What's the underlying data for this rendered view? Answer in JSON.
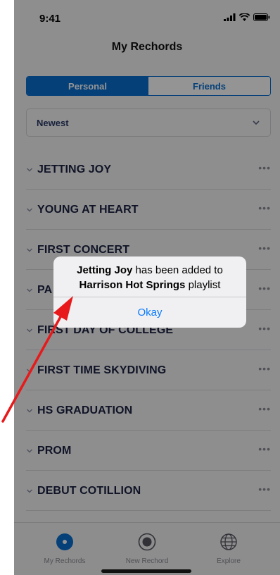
{
  "status_bar": {
    "time": "9:41",
    "icons": [
      "signal-icon",
      "wifi-icon",
      "battery-icon"
    ]
  },
  "header": {
    "title": "My Rechords"
  },
  "segments": [
    {
      "label": "Personal",
      "active": true
    },
    {
      "label": "Friends",
      "active": false
    }
  ],
  "sort": {
    "selected": "Newest"
  },
  "list": {
    "items": [
      {
        "title": "JETTING JOY"
      },
      {
        "title": "YOUNG AT HEART"
      },
      {
        "title": "FIRST CONCERT"
      },
      {
        "title": "PA"
      },
      {
        "title": "FIRST DAY OF COLLEGE"
      },
      {
        "title": "FIRST TIME SKYDIVING"
      },
      {
        "title": "HS GRADUATION"
      },
      {
        "title": "PROM"
      },
      {
        "title": "DEBUT COTILLION"
      }
    ],
    "more_label": "•••"
  },
  "alert": {
    "message_part1": "Jetting Joy",
    "message_part2": " has been added to",
    "message_part3": "Harrison Hot Springs",
    "message_part4": " playlist",
    "button_label": "Okay"
  },
  "tab_bar": {
    "tabs": [
      {
        "label": "My Rechords",
        "icon": "record-icon",
        "active": true
      },
      {
        "label": "New Rechord",
        "icon": "record-button-icon",
        "active": false
      },
      {
        "label": "Explore",
        "icon": "globe-icon",
        "active": false
      }
    ]
  },
  "colors": {
    "accent": "#0a6ed1",
    "alert_button": "#0a7aff",
    "annotation_arrow": "#e8191a"
  }
}
